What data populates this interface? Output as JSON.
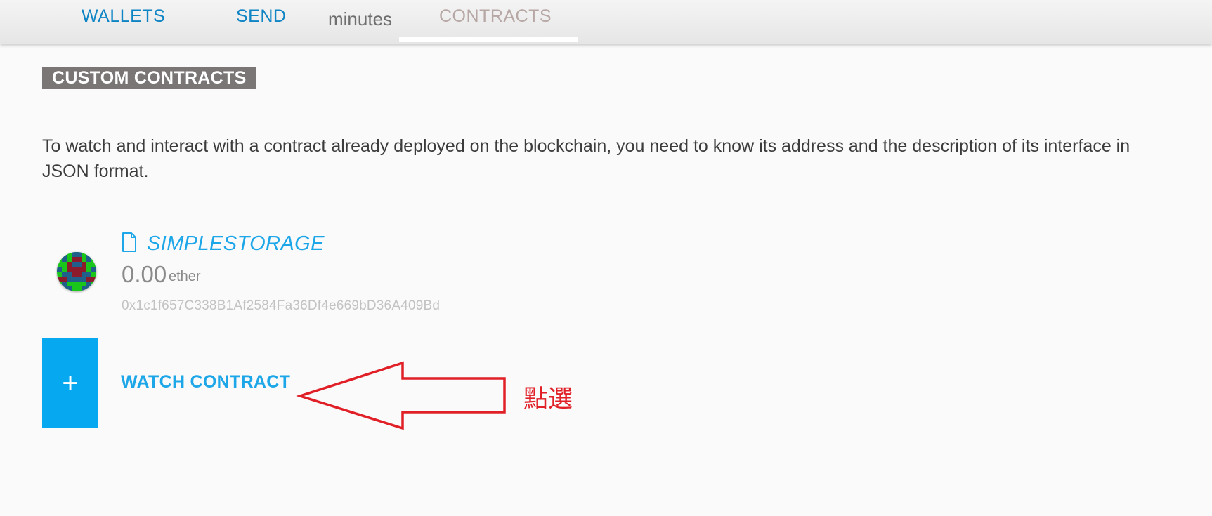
{
  "nav": {
    "tabs": [
      {
        "label": "WALLETS"
      },
      {
        "label": "SEND"
      },
      {
        "label": "minutes"
      },
      {
        "label": "CONTRACTS"
      }
    ],
    "accent_color": "#0e84c4",
    "active_tab": "CONTRACTS"
  },
  "section": {
    "heading": "CUSTOM CONTRACTS",
    "description": "To watch and interact with a contract already deployed on the blockchain, you need to know its address and the description of its interface in JSON format."
  },
  "contract": {
    "name": "SIMPLESTORAGE",
    "balance": "0.00",
    "unit": "ether",
    "address": "0x1c1f657C338B1Af2584Fa36Df4e669bD36A409Bd",
    "icon": "file-icon"
  },
  "watch": {
    "symbol": "+",
    "label": "WATCH CONTRACT",
    "button_color": "#06a8ef"
  },
  "annotation": {
    "text": "點選",
    "color": "#e01f26",
    "icon": "arrow-left-icon"
  }
}
